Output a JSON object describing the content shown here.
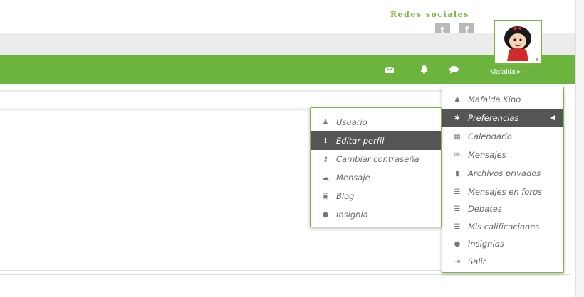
{
  "social": {
    "title": "Redes sociales",
    "twitter_label": "t",
    "facebook_label": "f"
  },
  "user": {
    "name_link": "Mafalda ▸"
  },
  "icons": {
    "envelope": "envelope-icon",
    "bell": "bell-icon",
    "chat": "comment-icon"
  },
  "colors": {
    "brand_green": "#6bb43e",
    "active_item": "#555555",
    "social_gray": "#b8b8b8"
  },
  "user_menu": {
    "items": [
      {
        "icon": "user-icon",
        "glyph": "♟",
        "label": "Mafalda Kino"
      },
      {
        "icon": "gear-icon",
        "glyph": "✱",
        "label": "Preferencias",
        "caret": "◀"
      },
      {
        "icon": "calendar-icon",
        "glyph": "▦",
        "label": "Calendario"
      },
      {
        "icon": "envelope-icon",
        "glyph": "✉",
        "label": "Mensajes"
      },
      {
        "icon": "file-icon",
        "glyph": "▮",
        "label": "Archivos privados"
      },
      {
        "icon": "list-icon",
        "glyph": "☰",
        "label": "Mensajes en foros"
      },
      {
        "icon": "list-icon",
        "glyph": "☰",
        "label": "Debates"
      },
      {
        "icon": "list-icon",
        "glyph": "☰",
        "label": "Mis calificaciones"
      },
      {
        "icon": "badge-icon",
        "glyph": "●",
        "label": "Insignias"
      },
      {
        "icon": "sign-out-icon",
        "glyph": "⇥",
        "label": "Salir"
      }
    ]
  },
  "pref_menu": {
    "items": [
      {
        "icon": "user-icon",
        "glyph": "♟",
        "label": "Usuario"
      },
      {
        "icon": "info-icon",
        "glyph": "ℹ",
        "label": "Editar perfil"
      },
      {
        "icon": "key-icon",
        "glyph": "⚷",
        "label": "Cambiar contraseña"
      },
      {
        "icon": "comments-icon",
        "glyph": "☁",
        "label": "Mensaje"
      },
      {
        "icon": "blog-icon",
        "glyph": "▣",
        "label": "Blog"
      },
      {
        "icon": "badge-icon",
        "glyph": "●",
        "label": "Insignia"
      }
    ]
  }
}
